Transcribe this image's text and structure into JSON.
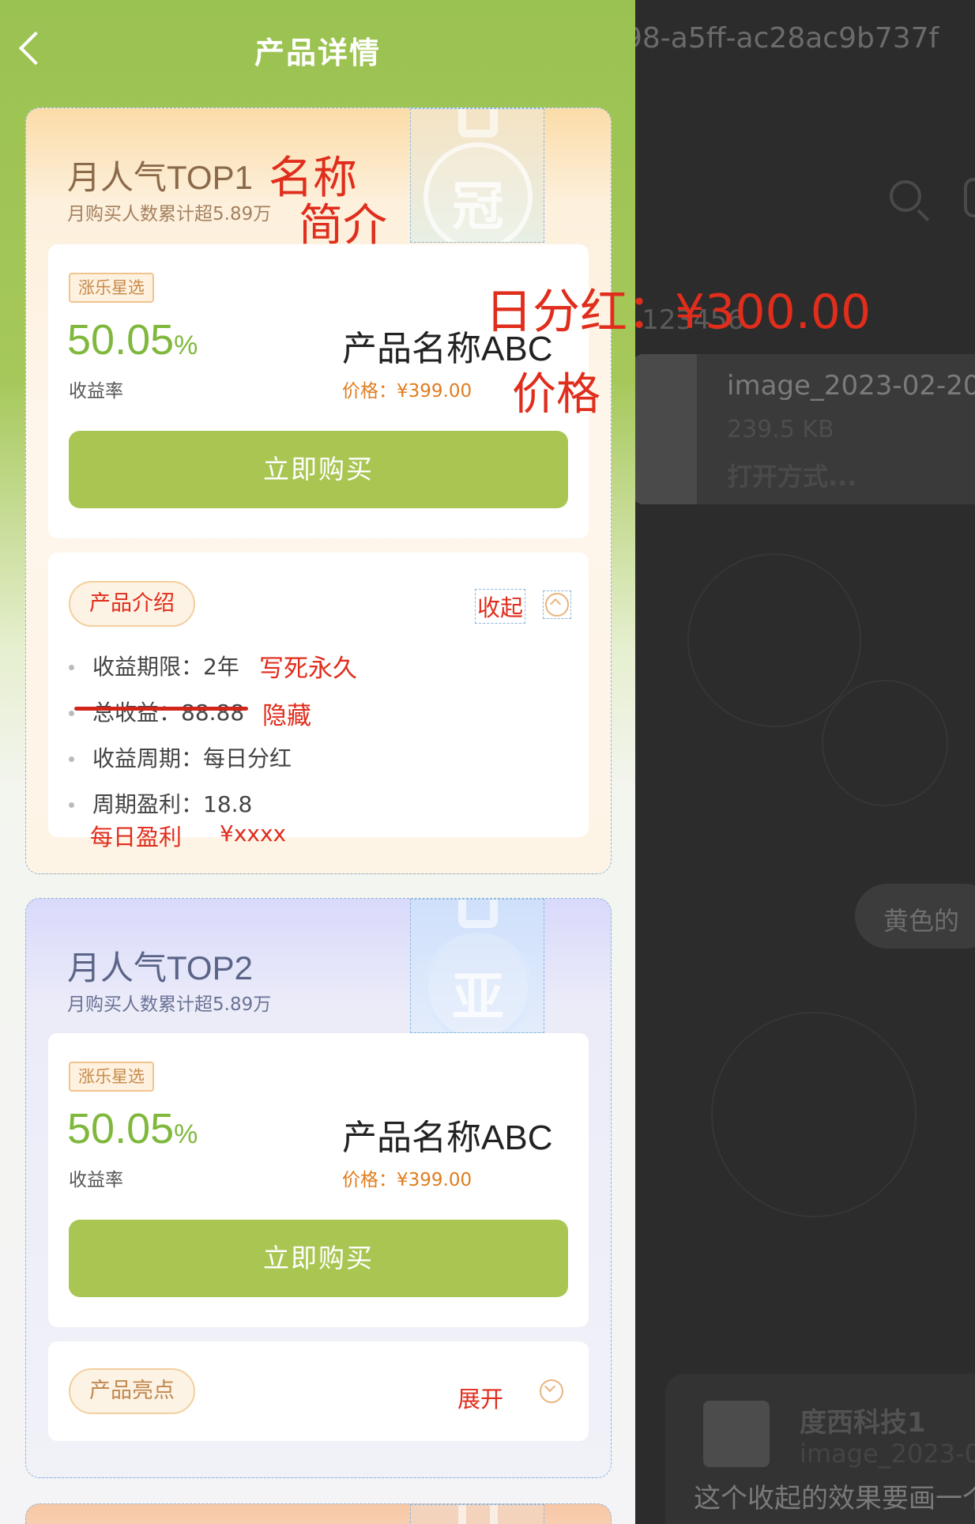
{
  "background": {
    "uuid": "98-a5ff-ac28ac9b737f",
    "number": ": 123456",
    "file": {
      "name": "image_2023-02-20_",
      "size": "239.5 KB",
      "open_with": "打开方式..."
    },
    "pill_text": "黄色的",
    "card": {
      "company": "度西科技1",
      "image_name": "image_2023-0",
      "message": "这个收起的效果要画一个"
    }
  },
  "nav": {
    "title": "产品详情",
    "back_icon": "chevron-left-icon"
  },
  "annotations": {
    "name": "名称",
    "intro": "简介",
    "daily_dividend": "日分红：¥300.00",
    "price": "价格",
    "fixed_forever": "写死永久",
    "hidden": "隐藏",
    "daily_profit": "每日盈利",
    "daily_profit_value": "¥xxxx"
  },
  "products": [
    {
      "rank_title": "月人气TOP1",
      "rank_subtitle": "月购买人数累计超5.89万",
      "medal_char": "冠",
      "tag": "涨乐星选",
      "rate": "50.05",
      "rate_unit": "%",
      "rate_label": "收益率",
      "name": "产品名称ABC",
      "price": "价格：¥399.00",
      "buy_label": "立即购买",
      "section_title": "产品介绍",
      "toggle_label": "收起",
      "expanded": true,
      "details": [
        "收益期限：2年",
        "总收益：88.88",
        "收益周期：每日分红",
        "周期盈利：18.8"
      ]
    },
    {
      "rank_title": "月人气TOP2",
      "rank_subtitle": "月购买人数累计超5.89万",
      "medal_char": "亚",
      "tag": "涨乐星选",
      "rate": "50.05",
      "rate_unit": "%",
      "rate_label": "收益率",
      "name": "产品名称ABC",
      "price": "价格：¥399.00",
      "buy_label": "立即购买",
      "section_title": "产品亮点",
      "toggle_label": "展开",
      "expanded": false
    }
  ]
}
